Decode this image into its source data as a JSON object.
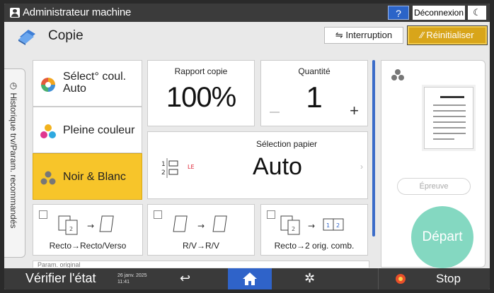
{
  "topbar": {
    "admin_label": "Administrateur machine",
    "help_label": "?",
    "logout_label": "Déconnexion",
    "moon_label": "☾"
  },
  "header": {
    "title": "Copie",
    "interrupt_label": "Interruption",
    "reset_label": "Réinitialiser"
  },
  "side_tab": {
    "label": "Historique trv/Param. recommandés"
  },
  "color_modes": [
    {
      "label": "Sélect° coul. Auto",
      "selected": false
    },
    {
      "label": "Pleine couleur",
      "selected": false
    },
    {
      "label": "Noir & Blanc",
      "selected": true
    }
  ],
  "ratio": {
    "title": "Rapport copie",
    "value": "100%"
  },
  "quantity": {
    "title": "Quantité",
    "value": "1",
    "minus": "—",
    "plus": "+"
  },
  "paper": {
    "title": "Sélection papier",
    "value": "Auto"
  },
  "duplex": [
    {
      "label": "Recto→Recto/Verso"
    },
    {
      "label": "R/V→R/V"
    },
    {
      "label": "Recto→2 orig. comb."
    }
  ],
  "more_strip": {
    "label": "Param. original"
  },
  "preview": {
    "proof_label": "Épreuve",
    "start_label": "Départ"
  },
  "bottombar": {
    "check_label": "Vérifier l'état",
    "date": "26 janv. 2025",
    "time": "11:41",
    "stop_label": "Stop"
  },
  "colors": {
    "accent": "#2f63c9",
    "selected": "#f7c52a",
    "reset": "#d8a51a",
    "start": "#84d8c1"
  }
}
